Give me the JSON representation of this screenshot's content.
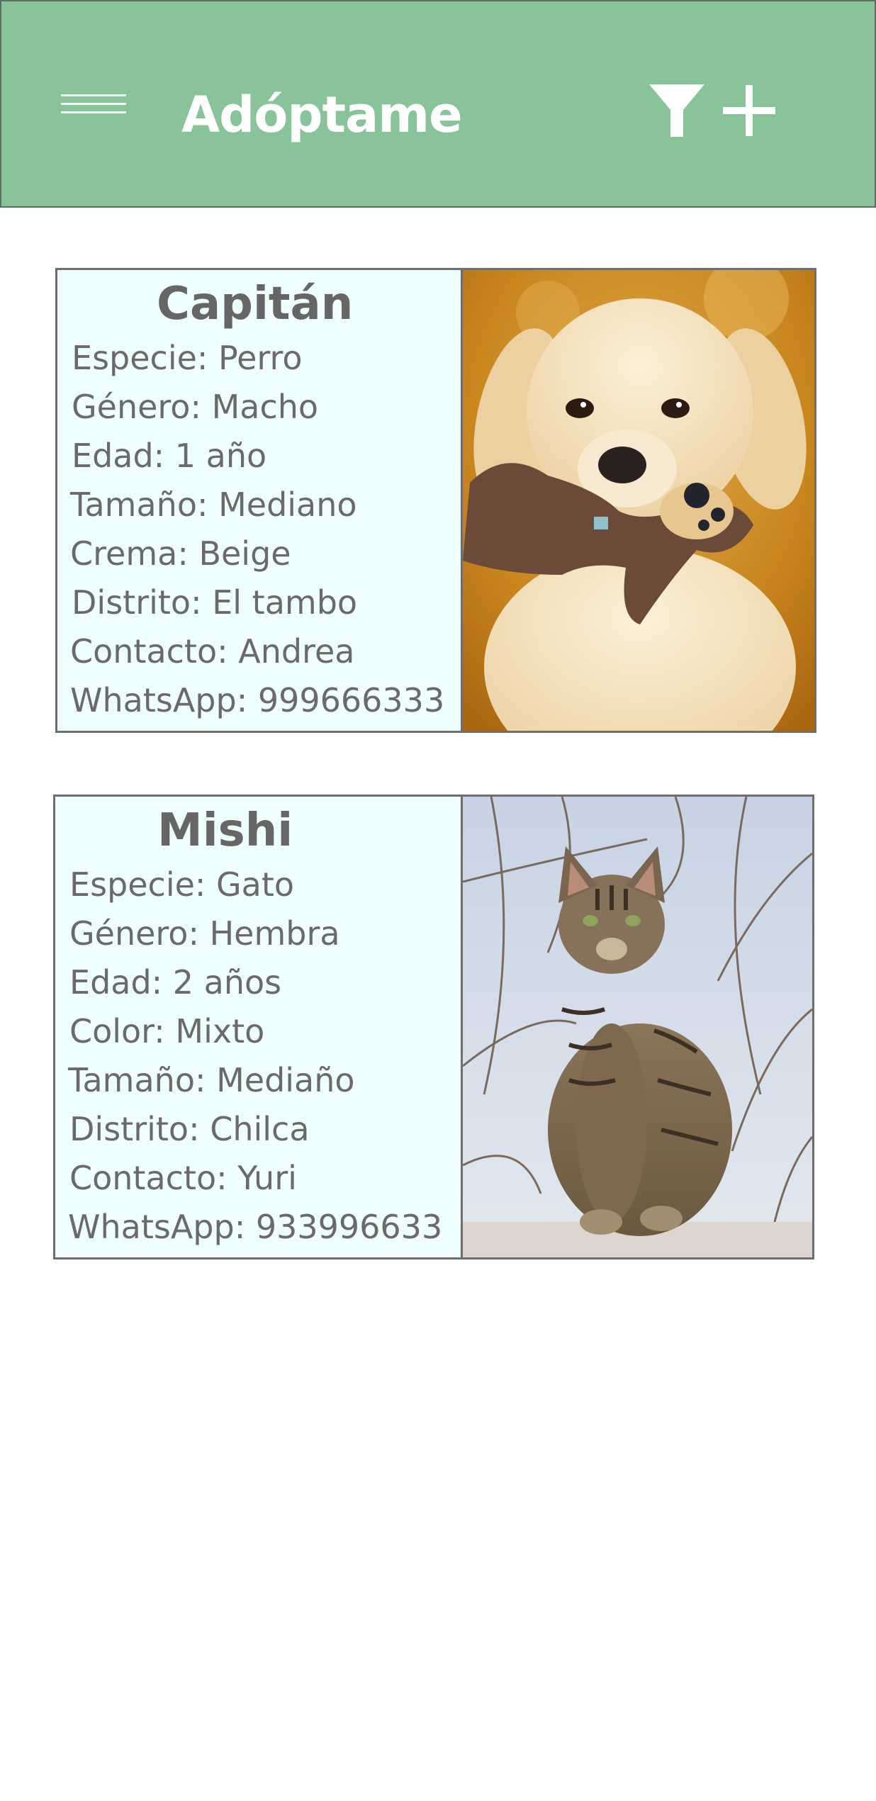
{
  "app_bar": {
    "title": "Adóptame",
    "background_color": "#88c399",
    "icons": [
      "menu-icon",
      "filter-icon",
      "add-icon"
    ]
  },
  "pets": [
    {
      "name": "Capitán",
      "fields": [
        "Especie: Perro",
        "Género: Macho",
        "Edad: 1 año",
        "Tamaño: Mediano",
        "Crema: Beige",
        "Distrito: El tambo",
        "Contacto: Andrea",
        "WhatsApp: 999666333"
      ]
    },
    {
      "name": "Mishi",
      "fields": [
        "Especie: Gato",
        "Género: Hembra",
        "Edad: 2 años",
        "Color: Mixto",
        "Tamaño: Mediaño",
        "Distrito: Chilca",
        "Contacto: Yuri",
        "WhatsApp: 933996633"
      ]
    }
  ]
}
